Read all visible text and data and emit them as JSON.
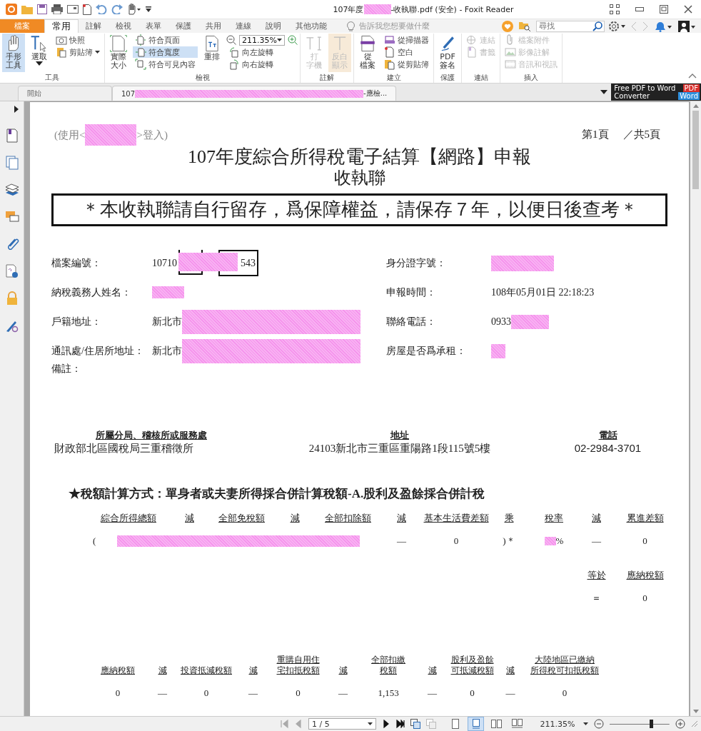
{
  "window": {
    "title_prefix": "107年度",
    "title_suffix": "-收執聯.pdf (安全) - Foxit Reader"
  },
  "ribbon": {
    "tabs": [
      {
        "label": "檔案",
        "kind": "file",
        "selected": false
      },
      {
        "label": "常用",
        "kind": "tab",
        "selected": true
      },
      {
        "label": "註解",
        "kind": "tab",
        "selected": false
      },
      {
        "label": "檢視",
        "kind": "tab",
        "selected": false
      },
      {
        "label": "表單",
        "kind": "tab",
        "selected": false
      },
      {
        "label": "保護",
        "kind": "tab",
        "selected": false
      },
      {
        "label": "共用",
        "kind": "tab",
        "selected": false
      },
      {
        "label": "連線",
        "kind": "tab",
        "selected": false
      },
      {
        "label": "說明",
        "kind": "tab",
        "selected": false
      },
      {
        "label": "其他功能",
        "kind": "tab",
        "selected": false
      }
    ],
    "hint": "告訴我您想要做什麼",
    "search": {
      "placeholder": "尋找"
    },
    "groups": [
      {
        "label": "工具",
        "items": [
          {
            "kind": "large",
            "lines": [
              "手形",
              "工具"
            ],
            "selected": true,
            "disabled": false,
            "dropdown": false
          },
          {
            "kind": "large",
            "lines": [
              "選取"
            ],
            "selected": false,
            "disabled": false,
            "dropdown": true
          },
          {
            "kind": "stack",
            "items": [
              {
                "label": "快照",
                "selected": false,
                "disabled": false,
                "dropdown": false
              },
              {
                "label": "剪貼簿",
                "selected": false,
                "disabled": false,
                "dropdown": true
              }
            ]
          }
        ]
      },
      {
        "label": "檢視",
        "items": [
          {
            "kind": "large",
            "lines": [
              "實際",
              "大小"
            ],
            "selected": false,
            "disabled": false,
            "dropdown": false
          },
          {
            "kind": "stack",
            "items": [
              {
                "label": "符合頁面",
                "selected": false,
                "disabled": false,
                "dropdown": false
              },
              {
                "label": "符合寬度",
                "selected": true,
                "disabled": false,
                "dropdown": false
              },
              {
                "label": "符合可見內容",
                "selected": false,
                "disabled": false,
                "dropdown": false
              }
            ]
          },
          {
            "kind": "large",
            "lines": [
              "重排"
            ],
            "selected": false,
            "disabled": false,
            "dropdown": false
          },
          {
            "kind": "zoomstack",
            "zoom": "211.35%",
            "items": [
              {
                "label": "向左旋轉",
                "selected": false,
                "disabled": false,
                "dropdown": false
              },
              {
                "label": "向右旋轉",
                "selected": false,
                "disabled": false,
                "dropdown": false
              }
            ]
          }
        ]
      },
      {
        "label": "註解",
        "items": [
          {
            "kind": "large",
            "lines": [
              "打",
              "字機"
            ],
            "selected": false,
            "disabled": true,
            "dropdown": false
          },
          {
            "kind": "large",
            "lines": [
              "反白",
              "顯示"
            ],
            "selected": true,
            "disabled": true,
            "dropdown": false
          }
        ]
      },
      {
        "label": "建立",
        "items": [
          {
            "kind": "large",
            "lines": [
              "從",
              "檔案"
            ],
            "selected": false,
            "disabled": false,
            "dropdown": false
          },
          {
            "kind": "stack",
            "items": [
              {
                "label": "從掃描器",
                "selected": false,
                "disabled": false,
                "dropdown": false
              },
              {
                "label": "空白",
                "selected": false,
                "disabled": false,
                "dropdown": false
              },
              {
                "label": "從剪貼簿",
                "selected": false,
                "disabled": false,
                "dropdown": false
              }
            ]
          }
        ]
      },
      {
        "label": "保護",
        "items": [
          {
            "kind": "large",
            "lines": [
              "PDF",
              "簽名"
            ],
            "selected": false,
            "disabled": false,
            "dropdown": false
          }
        ]
      },
      {
        "label": "連結",
        "items": [
          {
            "kind": "stack",
            "items": [
              {
                "label": "連結",
                "selected": false,
                "disabled": true,
                "dropdown": false
              },
              {
                "label": "書籤",
                "selected": false,
                "disabled": true,
                "dropdown": false
              }
            ]
          }
        ]
      },
      {
        "label": "插入",
        "items": [
          {
            "kind": "stack",
            "items": [
              {
                "label": "檔案附件",
                "selected": false,
                "disabled": true,
                "dropdown": false
              },
              {
                "label": "影像註解",
                "selected": false,
                "disabled": true,
                "dropdown": false
              },
              {
                "label": "音訊和視訊",
                "selected": false,
                "disabled": true,
                "dropdown": false
              }
            ]
          }
        ]
      }
    ]
  },
  "doc_tabs": [
    {
      "label": "開始",
      "selected": false
    },
    {
      "label": "107",
      "label_end": "-應檢...",
      "selected": true
    }
  ],
  "ad": {
    "line1": "Free PDF to Word",
    "line2": "Converter",
    "badge_top": "PDF",
    "badge_bottom": "Word"
  },
  "document": {
    "login_prefix": "(使用<",
    "login_suffix": ">登入)",
    "page_no": "第1頁",
    "page_total": "／共5頁",
    "title": "107年度綜合所得稅電子結算【網路】申報",
    "subtitle": "收執聯",
    "notice": "＊本收執聯請自行留存，爲保障權益，請保存７年，以便日後查考＊",
    "fields": [
      {
        "label": "檔案編號：",
        "value": "10710",
        "value_end": "543",
        "kind": "boxed"
      },
      {
        "label": "身分證字號：",
        "kind": "hidden"
      },
      {
        "label": "納稅義務人姓名：",
        "kind": "hidden"
      },
      {
        "label": "申報時間：",
        "value": "108年05月01日  22:18:23",
        "kind": "plain"
      },
      {
        "label": "戶籍地址：",
        "value": "新北市",
        "kind": "address"
      },
      {
        "label": "聯絡電話：",
        "value": "0933",
        "kind": "phone"
      },
      {
        "label": "通訊處/住居所地址：",
        "value": "新北市",
        "kind": "address"
      },
      {
        "label": "房屋是否爲承租：",
        "kind": "small"
      }
    ],
    "remarks": "備註：",
    "office": {
      "headers": [
        "所屬分局、稽核所或服務處",
        "地址",
        "電話"
      ],
      "values": [
        "財政部北區國稅局三重稽徵所",
        "24103新北市三重區重陽路1段115號5樓",
        "02-2984-3701"
      ]
    },
    "calc_title": "★稅額計算方式：單身者或夫妻所得採合併計算稅額-A.股利及盈餘採合併計稅",
    "calc_headers": [
      "綜合所得總額",
      "減",
      "全部免稅額",
      "減",
      "全部扣除額",
      "減",
      "基本生活費差額",
      "乘",
      "稅率",
      "減",
      "累進差額"
    ],
    "calc_values": [
      {
        "text": "(",
        "redacted": true
      },
      {
        "text": "—",
        "redacted": false
      },
      {
        "text": "0",
        "redacted": false
      },
      {
        "text": ")＊",
        "redacted": false
      },
      {
        "text": "%",
        "redacted": true
      },
      {
        "text": "—",
        "redacted": false
      },
      {
        "text": "0",
        "redacted": false
      }
    ],
    "result": {
      "headers": [
        "等於",
        "應納稅額"
      ],
      "values": [
        "＝",
        "0"
      ]
    },
    "credit_headers": [
      [
        "應納稅額"
      ],
      [
        "減"
      ],
      [
        "投資抵減稅額"
      ],
      [
        "減"
      ],
      [
        "重購自用住",
        "宅扣抵稅額"
      ],
      [
        "減"
      ],
      [
        "全部扣繳",
        "稅額"
      ],
      [
        "減"
      ],
      [
        "股利及盈餘",
        "可抵減稅額"
      ],
      [
        "減"
      ],
      [
        "大陸地區已繳納",
        "所得稅可扣抵稅額"
      ]
    ],
    "credit_values": [
      "0",
      "—",
      "0",
      "—",
      "0",
      "—",
      "1,153",
      "—",
      "0",
      "—",
      "0"
    ]
  },
  "status_bar": {
    "nav": [
      {
        "disabled": true
      },
      {
        "disabled": true
      },
      {
        "disabled": false
      },
      {
        "disabled": false
      }
    ],
    "page": "1 / 5",
    "views": [
      {
        "selected": false
      },
      {
        "selected": true
      },
      {
        "selected": false
      },
      {
        "selected": false
      }
    ],
    "zoom": "211.35%",
    "level": 0.7
  }
}
